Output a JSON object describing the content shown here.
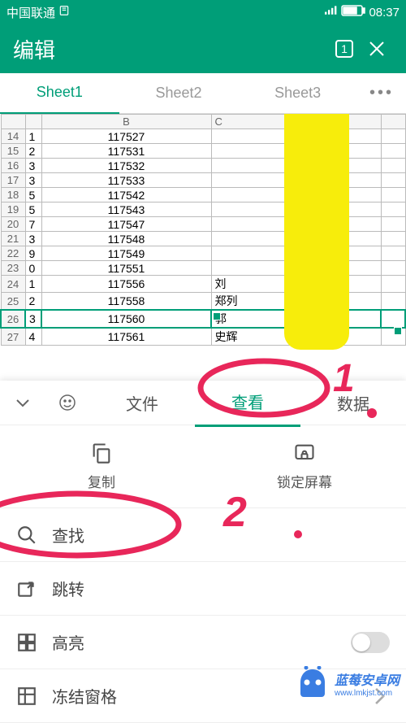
{
  "status": {
    "carrier": "中国联通",
    "time": "08:37"
  },
  "header": {
    "title": "编辑",
    "tab_count": "1"
  },
  "sheets": {
    "s1": "Sheet1",
    "s2": "Sheet2",
    "s3": "Sheet3"
  },
  "cols": {
    "b": "B",
    "c": "C"
  },
  "rows": [
    {
      "n": "14",
      "a": "1",
      "b": "117527",
      "c": ""
    },
    {
      "n": "15",
      "a": "2",
      "b": "117531",
      "c": ""
    },
    {
      "n": "16",
      "a": "3",
      "b": "117532",
      "c": ""
    },
    {
      "n": "17",
      "a": "3",
      "b": "117533",
      "c": ""
    },
    {
      "n": "18",
      "a": "5",
      "b": "117542",
      "c": ""
    },
    {
      "n": "19",
      "a": "5",
      "b": "117543",
      "c": ""
    },
    {
      "n": "20",
      "a": "7",
      "b": "117547",
      "c": ""
    },
    {
      "n": "21",
      "a": "3",
      "b": "117548",
      "c": ""
    },
    {
      "n": "22",
      "a": "9",
      "b": "117549",
      "c": ""
    },
    {
      "n": "23",
      "a": "0",
      "b": "117551",
      "c": ""
    },
    {
      "n": "24",
      "a": "1",
      "b": "117556",
      "c": "刘"
    },
    {
      "n": "25",
      "a": "2",
      "b": "117558",
      "c": "郑列"
    },
    {
      "n": "26",
      "a": "3",
      "b": "117560",
      "c": "郭"
    },
    {
      "n": "27",
      "a": "4",
      "b": "117561",
      "c": "史辉"
    }
  ],
  "mid_tabs": {
    "file": "文件",
    "view": "查看",
    "data": "数据"
  },
  "actions": {
    "copy": "复制",
    "lock": "锁定屏幕"
  },
  "menu": {
    "find": "查找",
    "goto": "跳转",
    "highlight": "高亮",
    "freeze": "冻结窗格"
  },
  "annotations": {
    "one": "1",
    "two": "2"
  },
  "watermark": {
    "text": "蓝莓安卓网",
    "url": "www.lmkjst.com"
  }
}
